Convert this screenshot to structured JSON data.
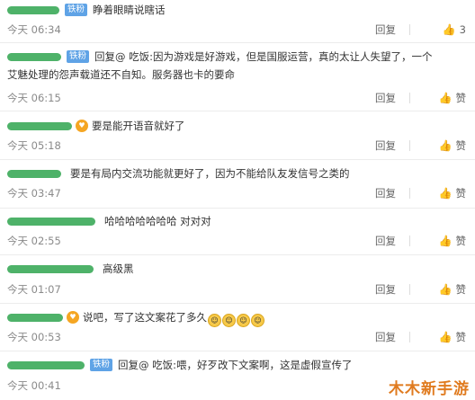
{
  "reply_label": "回复",
  "like_label": "赞",
  "badge_label": "铁粉",
  "watermark": "木木新手游",
  "comments": [
    {
      "text": "睁着眼睛说瞎话",
      "time": "今天 06:34",
      "likes": "3"
    },
    {
      "text": "回复@ 吃饭:因为游戏是好游戏，但是国服运营，真的太让人失望了，一个",
      "text2": "艾魅处理的怨声载道还不自知。服务器也卡的要命",
      "time": "今天 06:15",
      "likes": ""
    },
    {
      "text": "要是能开语音就好了",
      "time": "今天 05:18",
      "likes": ""
    },
    {
      "text": "要是有局内交流功能就更好了，因为不能给队友发信号之类的",
      "time": "今天 03:47",
      "likes": ""
    },
    {
      "text": "哈哈哈哈哈哈哈 对对对",
      "time": "今天 02:55",
      "likes": ""
    },
    {
      "text": "高级黑",
      "time": "今天 01:07",
      "likes": ""
    },
    {
      "text": "说吧，写了这文案花了多久",
      "time": "今天 00:53",
      "likes": ""
    },
    {
      "text": "回复@ 吃饭:喂，好歹改下文案啊，这是虚假宣传了",
      "time": "今天 00:41",
      "likes": ""
    }
  ]
}
